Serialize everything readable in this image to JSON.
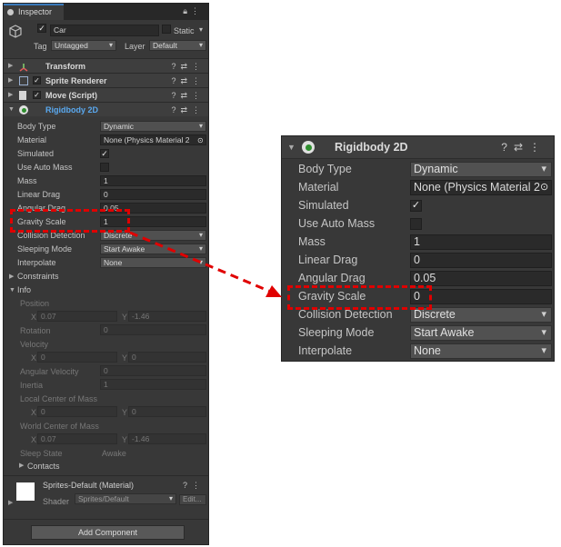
{
  "inspector": {
    "tab_label": "Inspector",
    "object_name": "Car",
    "static_label": "Static",
    "tag_label": "Tag",
    "tag_value": "Untagged",
    "layer_label": "Layer",
    "layer_value": "Default"
  },
  "components": [
    {
      "name": "Transform"
    },
    {
      "name": "Sprite Renderer"
    },
    {
      "name": "Move (Script)"
    },
    {
      "name": "Rigidbody 2D"
    }
  ],
  "rigidbody_left": {
    "body_type_label": "Body Type",
    "body_type_value": "Dynamic",
    "material_label": "Material",
    "material_value": "None (Physics Material 2",
    "simulated_label": "Simulated",
    "use_auto_mass_label": "Use Auto Mass",
    "mass_label": "Mass",
    "mass_value": "1",
    "linear_drag_label": "Linear Drag",
    "linear_drag_value": "0",
    "angular_drag_label": "Angular Drag",
    "angular_drag_value": "0.05",
    "gravity_scale_label": "Gravity Scale",
    "gravity_scale_value": "1",
    "collision_detection_label": "Collision Detection",
    "collision_detection_value": "Discrete",
    "sleeping_mode_label": "Sleeping Mode",
    "sleeping_mode_value": "Start Awake",
    "interpolate_label": "Interpolate",
    "interpolate_value": "None",
    "constraints_label": "Constraints",
    "info_label": "Info"
  },
  "info": {
    "position_label": "Position",
    "position_x": "0.07",
    "position_y": "-1.46",
    "rotation_label": "Rotation",
    "rotation_value": "0",
    "velocity_label": "Velocity",
    "velocity_x": "0",
    "velocity_y": "0",
    "angular_velocity_label": "Angular Velocity",
    "angular_velocity_value": "0",
    "inertia_label": "Inertia",
    "inertia_value": "1",
    "local_com_label": "Local Center of Mass",
    "local_com_x": "0",
    "local_com_y": "0",
    "world_com_label": "World Center of Mass",
    "world_com_x": "0.07",
    "world_com_y": "-1.46",
    "sleep_state_label": "Sleep State",
    "sleep_state_value": "Awake",
    "contacts_label": "Contacts",
    "x_label": "X",
    "y_label": "Y"
  },
  "material_section": {
    "name": "Sprites-Default (Material)",
    "shader_label": "Shader",
    "shader_value": "Sprites/Default",
    "edit_label": "Edit..."
  },
  "add_component_label": "Add Component",
  "rigidbody_zoom": {
    "title": "Rigidbody 2D",
    "body_type_label": "Body Type",
    "body_type_value": "Dynamic",
    "material_label": "Material",
    "material_value": "None (Physics Material 2",
    "simulated_label": "Simulated",
    "use_auto_mass_label": "Use Auto Mass",
    "mass_label": "Mass",
    "mass_value": "1",
    "linear_drag_label": "Linear Drag",
    "linear_drag_value": "0",
    "angular_drag_label": "Angular Drag",
    "angular_drag_value": "0.05",
    "gravity_scale_label": "Gravity Scale",
    "gravity_scale_value": "0",
    "collision_detection_label": "Collision Detection",
    "collision_detection_value": "Discrete",
    "sleeping_mode_label": "Sleeping Mode",
    "sleeping_mode_value": "Start Awake",
    "interpolate_label": "Interpolate",
    "interpolate_value": "None"
  },
  "colors": {
    "panel_bg": "#383838",
    "field_bg": "#2a2a2a",
    "annotation_red": "#e00000",
    "rigidbody_title": "#5aa9f0"
  }
}
